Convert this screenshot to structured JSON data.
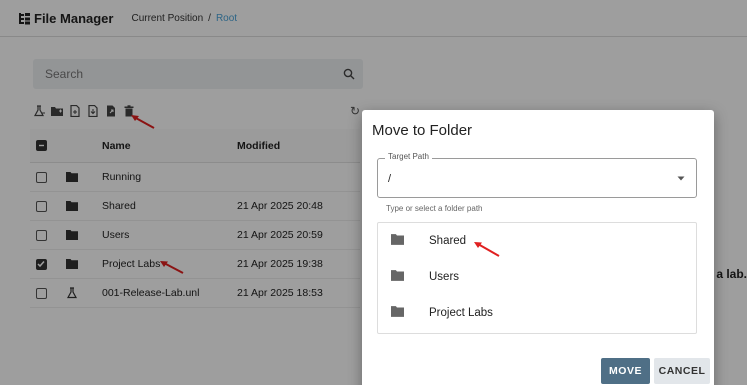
{
  "header": {
    "app_title": "File Manager",
    "breadcrumb_label": "Current Position",
    "breadcrumb_sep": "/",
    "breadcrumb_root": "Root"
  },
  "search": {
    "placeholder": "Search"
  },
  "toolbar": {
    "icons": [
      "add-lab-icon",
      "new-folder-icon",
      "new-file-icon",
      "import-icon",
      "move-icon",
      "delete-icon"
    ],
    "refresh_icon": "refresh-icon"
  },
  "table": {
    "headers": {
      "name": "Name",
      "modified": "Modified"
    },
    "rows": [
      {
        "name": "Running",
        "modified": "",
        "type": "folder",
        "checked": false
      },
      {
        "name": "Shared",
        "modified": "21 Apr 2025 20:48",
        "type": "folder",
        "checked": false
      },
      {
        "name": "Users",
        "modified": "21 Apr 2025 20:59",
        "type": "folder",
        "checked": false
      },
      {
        "name": "Project Labs",
        "modified": "21 Apr 2025 19:38",
        "type": "folder",
        "checked": true
      },
      {
        "name": "001-Release-Lab.unl",
        "modified": "21 Apr 2025 18:53",
        "type": "lab",
        "checked": false
      }
    ]
  },
  "side_text": ": a lab.",
  "modal": {
    "title": "Move to Folder",
    "target_label": "Target Path",
    "target_value": "/",
    "helper": "Type or select a folder path",
    "folders": [
      "Shared",
      "Users",
      "Project Labs"
    ],
    "move_label": "MOVE",
    "cancel_label": "CANCEL"
  },
  "colors": {
    "accent": "#4f6f86",
    "root_link": "#4aa3d8",
    "annotation_arrow": "#e02020"
  }
}
